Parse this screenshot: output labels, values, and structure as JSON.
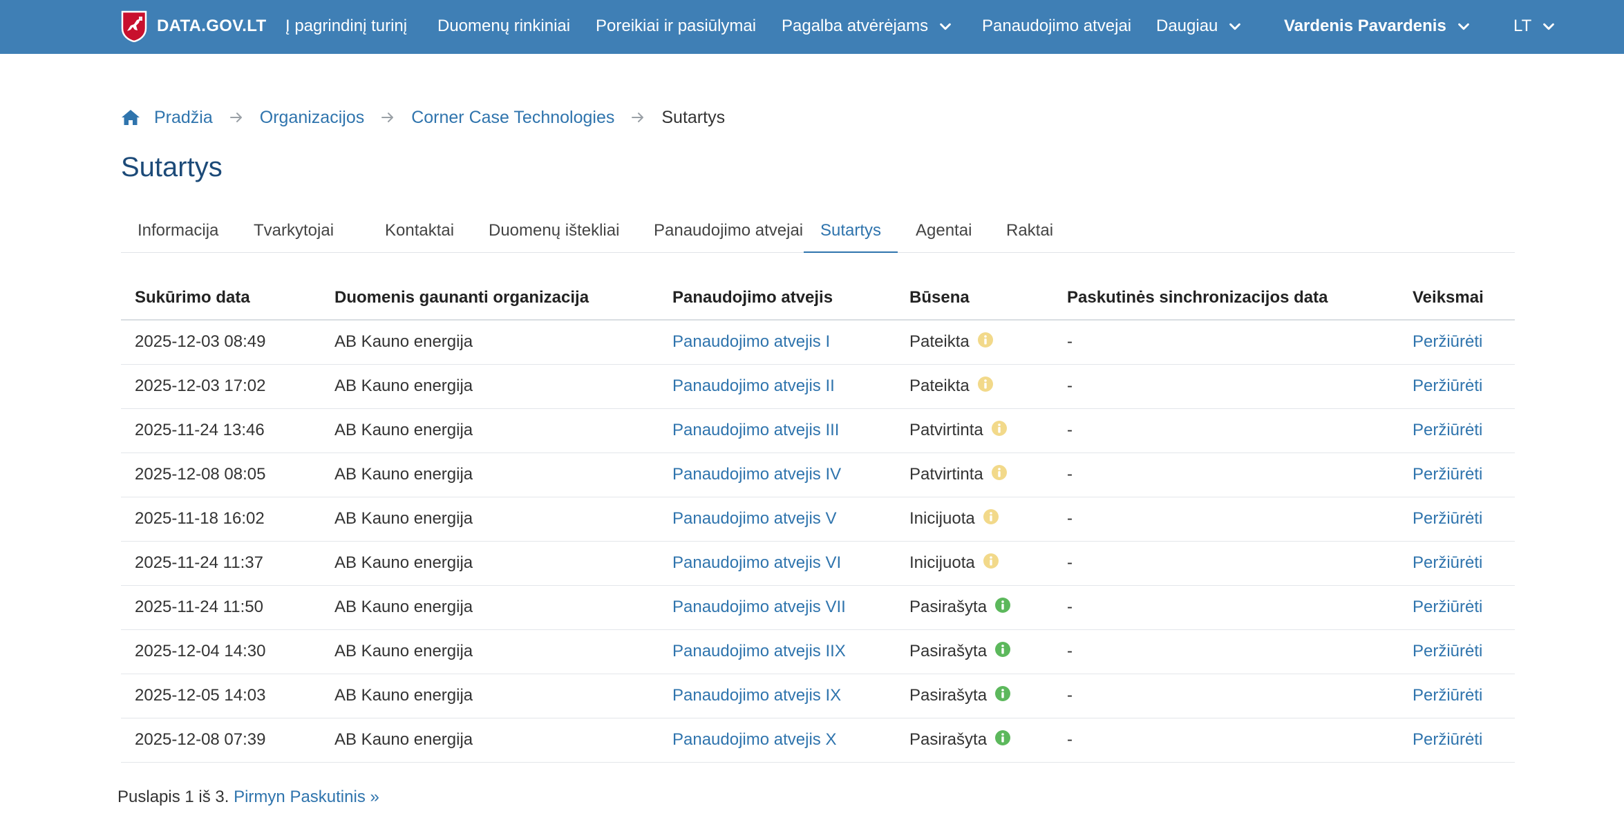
{
  "header": {
    "logo_text": "DATA.GOV.LT",
    "nav": [
      {
        "label": "Į pagrindinį turinį"
      },
      {
        "label": "Duomenų rinkiniai"
      },
      {
        "label": "Poreikiai ir pasiūlymai"
      },
      {
        "label": "Pagalba atvėrėjams"
      },
      {
        "label": "Panaudojimo atvejai"
      },
      {
        "label": "Daugiau"
      }
    ],
    "user_name": "Vardenis Pavardenis",
    "language": "LT"
  },
  "breadcrumb": {
    "home": "Pradžia",
    "organizations": "Organizacijos",
    "organization": "Corner Case Technologies",
    "current": "Sutartys"
  },
  "page_title": "Sutartys",
  "tabs": [
    {
      "label": "Informacija"
    },
    {
      "label": "Tvarkytojai"
    },
    {
      "label": "Kontaktai"
    },
    {
      "label": "Duomenų ištekliai"
    },
    {
      "label": "Panaudojimo atvejai"
    },
    {
      "label": "Sutartys"
    },
    {
      "label": "Agentai"
    },
    {
      "label": "Raktai"
    }
  ],
  "table": {
    "headers": {
      "created": "Sukūrimo data",
      "organization": "Duomenis gaunanti organizacija",
      "use_case": "Panaudojimo atvejis",
      "status": "Būsena",
      "sync": "Paskutinės sinchronizacijos data",
      "actions": "Veiksmai"
    },
    "rows": [
      {
        "created": "2025-12-03 08:49",
        "organization": "AB Kauno energija",
        "use_case": "Panaudojimo atvejis I",
        "status": "Pateikta",
        "sync": "-",
        "action": "Peržiūrėti"
      },
      {
        "created": "2025-12-03 17:02",
        "organization": "AB Kauno energija",
        "use_case": "Panaudojimo atvejis II",
        "status": "Pateikta",
        "sync": "-",
        "action": "Peržiūrėti"
      },
      {
        "created": "2025-11-24 13:46",
        "organization": "AB Kauno energija",
        "use_case": "Panaudojimo atvejis III",
        "status": "Patvirtinta",
        "sync": "-",
        "action": "Peržiūrėti"
      },
      {
        "created": "2025-12-08 08:05",
        "organization": "AB Kauno energija",
        "use_case": "Panaudojimo atvejis IV",
        "status": "Patvirtinta",
        "sync": "-",
        "action": "Peržiūrėti"
      },
      {
        "created": "2025-11-18 16:02",
        "organization": "AB Kauno energija",
        "use_case": "Panaudojimo atvejis V",
        "status": "Inicijuota",
        "sync": "-",
        "action": "Peržiūrėti"
      },
      {
        "created": "2025-11-24 11:37",
        "organization": "AB Kauno energija",
        "use_case": "Panaudojimo atvejis VI",
        "status": "Inicijuota",
        "sync": "-",
        "action": "Peržiūrėti"
      },
      {
        "created": "2025-11-24 11:50",
        "organization": "AB Kauno energija",
        "use_case": "Panaudojimo atvejis VII",
        "status": "Pasirašyta",
        "sync": "-",
        "action": "Peržiūrėti"
      },
      {
        "created": "2025-12-04 14:30",
        "organization": "AB Kauno energija",
        "use_case": "Panaudojimo atvejis IIX",
        "status": "Pasirašyta",
        "sync": "-",
        "action": "Peržiūrėti"
      },
      {
        "created": "2025-12-05 14:03",
        "organization": "AB Kauno energija",
        "use_case": "Panaudojimo atvejis IX",
        "status": "Pasirašyta",
        "sync": "-",
        "action": "Peržiūrėti"
      },
      {
        "created": "2025-12-08 07:39",
        "organization": "AB Kauno energija",
        "use_case": "Panaudojimo atvejis X",
        "status": "Pasirašyta",
        "sync": "-",
        "action": "Peržiūrėti"
      }
    ]
  },
  "pagination": {
    "text": "Puslapis 1 iš 3.",
    "next": "Pirmyn",
    "last": "Paskutinis »"
  },
  "colors": {
    "header_bg": "#3f7fb5",
    "link": "#2f74ad",
    "title": "#1c4a78",
    "pending_icon": "#f2d98a",
    "signed_icon": "#5cb85c"
  },
  "icons": {
    "logo": "lithuania-coat-of-arms-icon",
    "home": "home-icon",
    "separator": "arrow-right-icon",
    "dropdown": "chevron-down-icon",
    "status": "info-circle-icon"
  }
}
